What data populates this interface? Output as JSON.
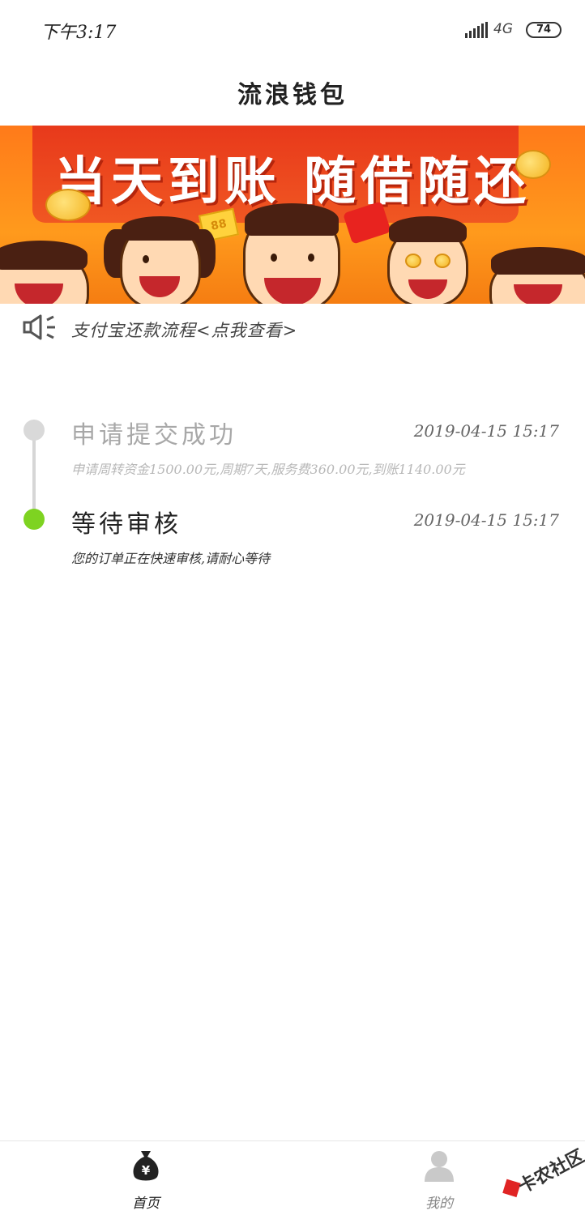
{
  "status_bar": {
    "time": "下午3:17",
    "network": "4G",
    "battery": "74"
  },
  "header": {
    "title": "流浪钱包"
  },
  "banner": {
    "slogan": "当天到账  随借随还",
    "coin_label": "88",
    "colors": {
      "background": "#ff8a1a",
      "slogan": "#ffffff"
    }
  },
  "notice": {
    "icon": "speaker-icon",
    "text": "支付宝还款流程<点我查看>"
  },
  "timeline": {
    "steps": [
      {
        "title": "申请提交成功",
        "time": "2019-04-15 15:17",
        "description": "申请周转资金1500.00元,周期7天,服务费360.00元,到账1140.00元",
        "state": "done",
        "dot_color": "#d9d9d9"
      },
      {
        "title": "等待审核",
        "time": "2019-04-15 15:17",
        "description": "您的订单正在快速审核,请耐心等待",
        "state": "current",
        "dot_color": "#7ed321"
      }
    ]
  },
  "bottom_nav": {
    "items": [
      {
        "label": "首页",
        "icon": "money-bag-icon",
        "active": true
      },
      {
        "label": "我的",
        "icon": "user-icon",
        "active": false
      }
    ]
  },
  "watermark": {
    "text": "卡农社区"
  }
}
